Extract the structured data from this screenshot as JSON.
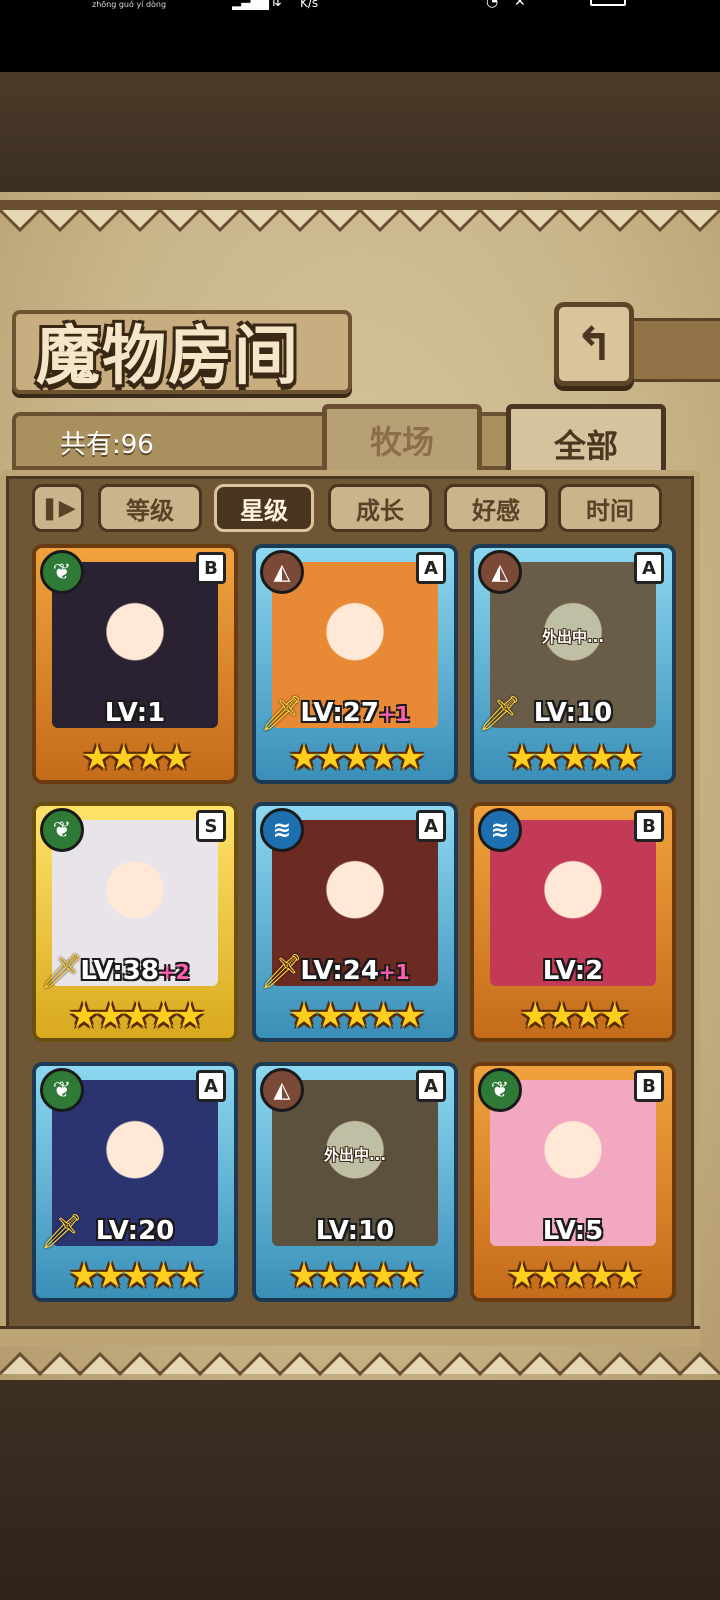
{
  "status_bar": {
    "carrier": "zhōng guó   yí  dòng",
    "speed": "K/s"
  },
  "header": {
    "title": "魔物房间",
    "back_icon": "back-arrow-icon"
  },
  "summary": {
    "count_label": "共有:96"
  },
  "tabs": [
    {
      "label": "牧场",
      "active": false
    },
    {
      "label": "全部",
      "active": true
    }
  ],
  "filters": {
    "pause_icon": "pause-toggle-icon",
    "items": [
      {
        "label": "等级",
        "active": false
      },
      {
        "label": "星级",
        "active": true
      },
      {
        "label": "成长",
        "active": false
      },
      {
        "label": "好感",
        "active": false
      },
      {
        "label": "时间",
        "active": false
      }
    ]
  },
  "monsters": [
    {
      "element": "nature",
      "rank": "B",
      "level": "LV:1",
      "bonus": "",
      "stars": 4,
      "frame": "orange",
      "away": false,
      "away_text": "",
      "sword": false,
      "portrait_color": "#2a2233"
    },
    {
      "element": "earth",
      "rank": "A",
      "level": "LV:27",
      "bonus": "+1",
      "stars": 5,
      "frame": "blue",
      "away": false,
      "away_text": "",
      "sword": true,
      "portrait_color": "#e88a35"
    },
    {
      "element": "earth",
      "rank": "A",
      "level": "LV:10",
      "bonus": "",
      "stars": 5,
      "frame": "blue",
      "away": true,
      "away_text": "外出中...",
      "sword": true,
      "portrait_color": "#7a6a52"
    },
    {
      "element": "nature",
      "rank": "S",
      "level": "LV:38",
      "bonus": "+2",
      "stars": 5,
      "frame": "gold",
      "away": false,
      "away_text": "",
      "sword": true,
      "portrait_color": "#e8e4ea"
    },
    {
      "element": "water",
      "rank": "A",
      "level": "LV:24",
      "bonus": "+1",
      "stars": 5,
      "frame": "blue",
      "away": false,
      "away_text": "",
      "sword": true,
      "portrait_color": "#6b2a22"
    },
    {
      "element": "water",
      "rank": "B",
      "level": "LV:2",
      "bonus": "",
      "stars": 4,
      "frame": "orange",
      "away": false,
      "away_text": "",
      "sword": false,
      "portrait_color": "#c23a55"
    },
    {
      "element": "nature",
      "rank": "A",
      "level": "LV:20",
      "bonus": "",
      "stars": 5,
      "frame": "blue",
      "away": false,
      "away_text": "",
      "sword": true,
      "portrait_color": "#2c3470"
    },
    {
      "element": "earth",
      "rank": "A",
      "level": "LV:10",
      "bonus": "",
      "stars": 5,
      "frame": "blue",
      "away": true,
      "away_text": "外出中...",
      "sword": false,
      "portrait_color": "#6e5a44"
    },
    {
      "element": "nature",
      "rank": "B",
      "level": "LV:5",
      "bonus": "",
      "stars": 5,
      "frame": "orange",
      "away": false,
      "away_text": "",
      "sword": false,
      "portrait_color": "#f2a8c0"
    }
  ]
}
